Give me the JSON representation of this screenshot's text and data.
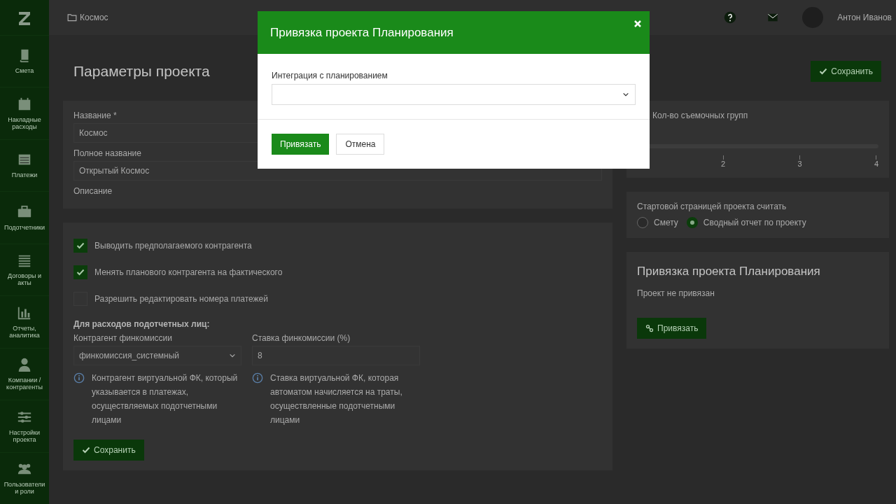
{
  "sidebar": {
    "items": [
      {
        "label": "Смета",
        "kind": "book"
      },
      {
        "label": "Накладные расходы",
        "kind": "calendar"
      },
      {
        "label": "Платежи",
        "kind": "table"
      },
      {
        "label": "Подотчетники",
        "kind": "briefcase"
      },
      {
        "label": "Договоры и акты",
        "kind": "list"
      },
      {
        "label": "Отчеты, аналитика",
        "kind": "chart"
      },
      {
        "label": "Компании / контрагенты",
        "kind": "person"
      },
      {
        "label": "Настройки проекта",
        "kind": "sliders"
      },
      {
        "label": "Пользователи и роли",
        "kind": "group"
      }
    ]
  },
  "topbar": {
    "breadcrumb": "Космос",
    "user_name": "Антон Иванов"
  },
  "page": {
    "title": "Параметры проекта",
    "save_button": "Сохранить"
  },
  "general": {
    "fields": [
      {
        "label": "Название *",
        "value": "Космос"
      },
      {
        "label": "Полное название",
        "value": "Открытый Космос"
      },
      {
        "label": "Описание"
      }
    ]
  },
  "options": {
    "checkboxes": [
      {
        "label": "Выводить предполагаемого контрагента",
        "checked": true
      },
      {
        "label": "Менять планового контрагента на фактического",
        "checked": true
      },
      {
        "label": "Разрешить редактировать номера платежей",
        "checked": false
      }
    ],
    "heading": "Для расходов подотчетных лиц:",
    "columns": [
      {
        "label": "Контрагент финкомиссии",
        "kind": "select",
        "value": "финкомиссия_системный",
        "note": "Контрагент виртуальной ФК, который указывается в платежах, осуществляемых подотчетными лицами"
      },
      {
        "label": "Ставка финкомиссии (%)",
        "kind": "input",
        "value": "8",
        "note": "Ставка виртуальной ФК, которая автоматом начисляется на траты, осуществленные подотчетными лицами"
      }
    ],
    "save_button": "Сохранить"
  },
  "crews": {
    "label": "Кол-во съемочных групп",
    "ticks": [
      "2",
      "3",
      "4"
    ]
  },
  "start_page": {
    "label": "Стартовой страницей проекта считать",
    "options": [
      {
        "label": "Смету",
        "selected": false
      },
      {
        "label": "Сводный отчет по проекту",
        "selected": true
      }
    ]
  },
  "planning": {
    "title": "Привязка проекта Планирования",
    "status": "Проект не привязан",
    "button": "Привязать"
  },
  "modal": {
    "title": "Привязка проекта Планирования",
    "field_label": "Интеграция с планированием",
    "buttons": [
      {
        "label": "Привязать",
        "kind": "primary"
      },
      {
        "label": "Отмена",
        "kind": "default"
      }
    ]
  }
}
